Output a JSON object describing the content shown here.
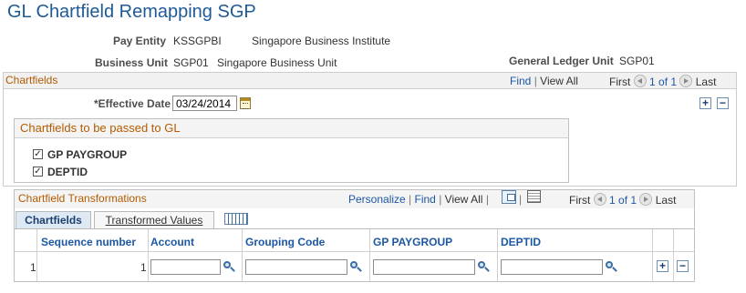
{
  "page": {
    "title": "GL Chartfield Remapping SGP"
  },
  "header": {
    "pay_entity_label": "Pay Entity",
    "pay_entity_code": "KSSGPBI",
    "pay_entity_desc": "Singapore Business Institute",
    "business_unit_label": "Business Unit",
    "business_unit_code": "SGP01",
    "business_unit_desc": "Singapore Business Unit",
    "gl_unit_label": "General Ledger Unit",
    "gl_unit_value": "SGP01"
  },
  "chartfields": {
    "section_title": "Chartfields",
    "find": "Find",
    "view_all": "View All",
    "first": "First",
    "pager": "1 of 1",
    "last": "Last",
    "effective_date_label": "*Effective Date",
    "effective_date_value": "03/24/2014",
    "passed_title": "Chartfields to be passed to GL",
    "options": [
      {
        "label": "GP PAYGROUP",
        "checked": true
      },
      {
        "label": "DEPTID",
        "checked": true
      }
    ]
  },
  "transformations": {
    "section_title": "Chartfield Transformations",
    "personalize": "Personalize",
    "find": "Find",
    "view_all": "View All",
    "first": "First",
    "pager": "1 of 1",
    "last": "Last",
    "tabs": [
      "Chartfields",
      "Transformed Values"
    ],
    "columns": [
      "Sequence number",
      "Account",
      "Grouping Code",
      "GP PAYGROUP",
      "DEPTID"
    ],
    "rows": [
      {
        "row_num": "1",
        "sequence": "1",
        "account": "",
        "grouping_code": "",
        "gp_paygroup": "",
        "deptid": ""
      }
    ]
  },
  "icons": {
    "nav_buttons": "circle-arrow-icon",
    "lookup": "magnifier-icon",
    "calendar": "calendar-icon",
    "add": "plus-icon",
    "delete": "minus-icon"
  },
  "colors": {
    "title": "#1e5a96",
    "section_title": "#b35b00",
    "link": "#1c57a4",
    "tab_active": "#dde9f5"
  }
}
